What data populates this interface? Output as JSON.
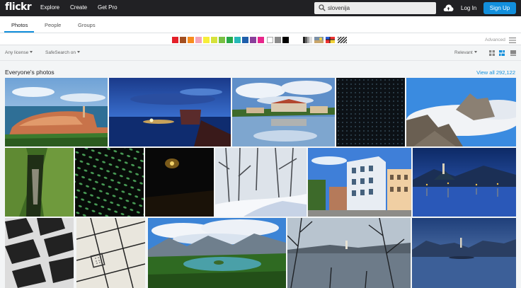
{
  "nav": {
    "logo": "flickr",
    "links": [
      "Explore",
      "Create",
      "Get Pro"
    ],
    "search_value": "slovenija",
    "login": "Log In",
    "signup": "Sign Up"
  },
  "tabs": [
    "Photos",
    "People",
    "Groups"
  ],
  "color_filter": {
    "swatches": [
      "#e4202a",
      "#a34f20",
      "#f78d1e",
      "#f3a3b8",
      "#f7ee3a",
      "#d6e23b",
      "#77c043",
      "#27a84a",
      "#27b9b8",
      "#1f5fab",
      "#8a3f9b",
      "#e8268b",
      "#ffffff",
      "#8a8a8a",
      "#000000"
    ],
    "advanced_label": "Advanced"
  },
  "filters": {
    "license": "Any license",
    "safesearch": "SafeSearch on",
    "sort": "Relevant"
  },
  "section": {
    "title": "Everyone's photos",
    "view_all": "View all 292,122"
  },
  "photos": [
    "coastal-town-peninsula",
    "sea-at-dusk-with-rocks",
    "lakeside-town-reflection",
    "dark-dotted-pattern",
    "mountain-peak-above-clouds",
    "green-gorge",
    "green-lights-grid",
    "dark-cave-light",
    "snowy-forest-path",
    "ornate-building-street",
    "lake-church-blue-hour",
    "dark-slats-pattern",
    "tiled-floor-drain",
    "lake-island-mountains",
    "bare-trees-lake-island",
    "lake-island-at-dawn"
  ]
}
